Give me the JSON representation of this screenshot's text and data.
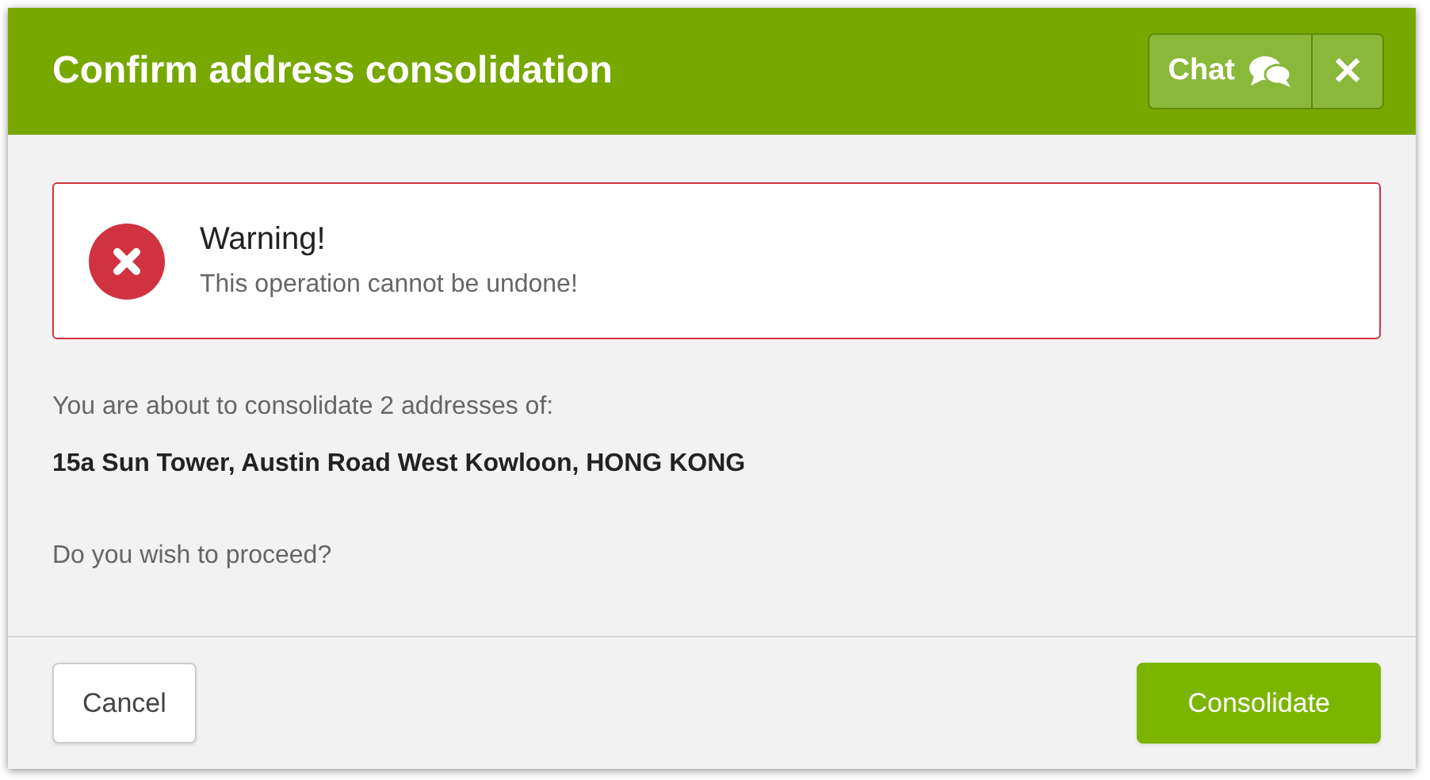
{
  "dialog": {
    "title": "Confirm address consolidation",
    "chat_button": "Chat",
    "close_button": "✕"
  },
  "warning": {
    "title": "Warning!",
    "message": "This operation cannot be undone!"
  },
  "intro": "You are about to consolidate 2 addresses of:",
  "address": "15a Sun Tower, Austin Road West Kowloon, HONG KONG",
  "question": "Do you wish to proceed?",
  "buttons": [
    {
      "label": "Cancel",
      "kind": "secondary"
    },
    {
      "label": "Consolidate",
      "kind": "primary"
    }
  ]
}
